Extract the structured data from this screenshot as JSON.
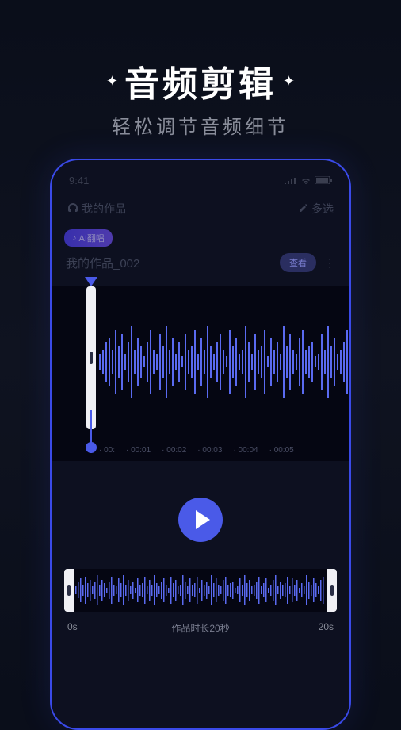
{
  "header": {
    "title": "音频剪辑",
    "subtitle": "轻松调节音频细节"
  },
  "status_bar": {
    "time": "9:41"
  },
  "app_header": {
    "my_works": "我的作品",
    "multi_select": "多选"
  },
  "card": {
    "ai_badge": "AI翻唱",
    "work_name": "我的作品_002",
    "view_btn": "查看"
  },
  "timeline": {
    "t1": "00:",
    "t2": "00:01",
    "t3": "00:02",
    "t4": "00:03",
    "t5": "00:04",
    "t6": "00:05"
  },
  "footer": {
    "start_time": "0s",
    "duration_label": "作品时长20秒",
    "end_time": "20s"
  }
}
